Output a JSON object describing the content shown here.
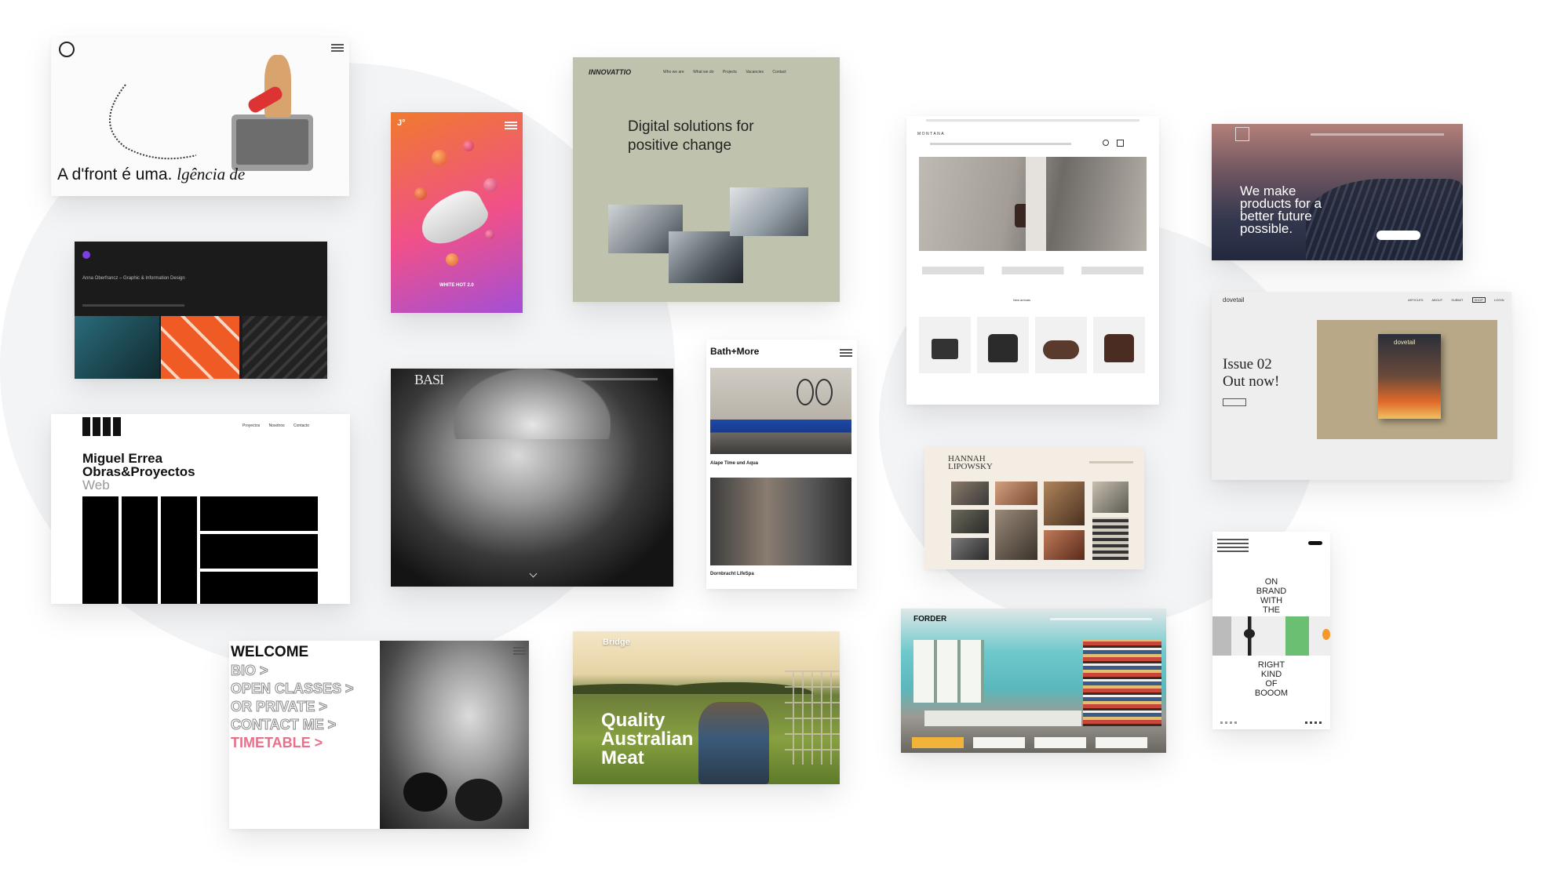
{
  "colors": {
    "sage": "#bfc3ad",
    "pink": "#e8708a",
    "dark": "#1b1b1b",
    "orange": "#f05a24"
  },
  "icons": [
    "menu-icon",
    "search-icon",
    "cart-icon",
    "arrow-down-icon",
    "logo-mark-icon"
  ],
  "dfront": {
    "headline_a": "A d'front é uma.",
    "headline_b": "lgência de"
  },
  "sneaker": {
    "logo": "J°",
    "caption": "WHITE HOT 2.0"
  },
  "innovattio": {
    "logo": "INNOVATTIO",
    "nav": [
      "Who we are",
      "What we do",
      "Projects",
      "Vacancies",
      "Contact"
    ],
    "headline_1": "Digital solutions for",
    "headline_2": "positive change"
  },
  "montana": {
    "logo": "MONTANA",
    "section": "New arrivals"
  },
  "sustain": {
    "headline": "We make products for a better future possible."
  },
  "dark_portfolio": {
    "title": "Anna Oberfrancz – Graphic & Information Design"
  },
  "miguel": {
    "nav": [
      "Proyectos",
      "Nosotros",
      "Contacto"
    ],
    "title_1": "Miguel Errea",
    "title_2": "Obras&Proyectos",
    "title_3": "Web"
  },
  "basi": {
    "logo": "BASI"
  },
  "bath": {
    "logo": "Bath+More",
    "item1": "Alape Time und Aqua",
    "item2": "Dornbracht LifeSpa"
  },
  "hannah": {
    "name_1": "HANNAH",
    "name_2": "LIPOWSKY"
  },
  "dovetail": {
    "logo": "dovetail",
    "nav": [
      "ARTICLES",
      "ABOUT",
      "SUBMIT",
      "SHOP",
      "LOGIN"
    ],
    "issue": "Issue 02",
    "out": "Out now!",
    "magazine": "dovetail"
  },
  "welcome": {
    "title": "WELCOME",
    "items": [
      "BIO >",
      "OPEN CLASSES >",
      "OR PRIVATE >",
      "CONTACT ME >"
    ],
    "timetable": "TIMETABLE >"
  },
  "bridge": {
    "logo": "Bridge",
    "line1": "Quality",
    "line2": "Australian",
    "line3": "Meat"
  },
  "forder": {
    "logo": "FORDER"
  },
  "booom": {
    "lines_a": [
      "ON",
      "BRAND",
      "WITH",
      "THE"
    ],
    "lines_b": [
      "RIGHT",
      "KIND",
      "OF",
      "BOOOM"
    ]
  }
}
